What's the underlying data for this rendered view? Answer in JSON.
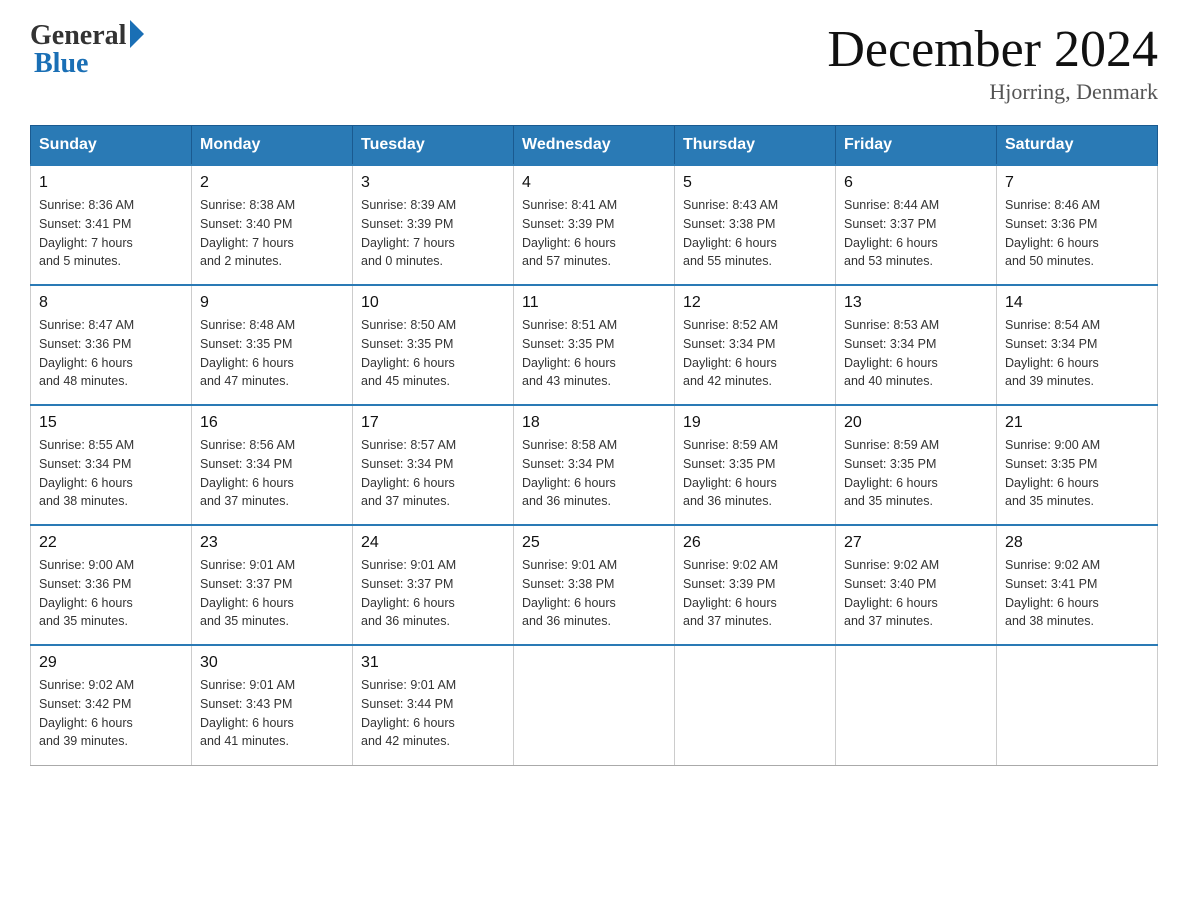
{
  "header": {
    "logo_general": "General",
    "logo_blue": "Blue",
    "title": "December 2024",
    "subtitle": "Hjorring, Denmark"
  },
  "days_of_week": [
    "Sunday",
    "Monday",
    "Tuesday",
    "Wednesday",
    "Thursday",
    "Friday",
    "Saturday"
  ],
  "weeks": [
    [
      {
        "day": "1",
        "sunrise": "8:36 AM",
        "sunset": "3:41 PM",
        "daylight": "7 hours and 5 minutes."
      },
      {
        "day": "2",
        "sunrise": "8:38 AM",
        "sunset": "3:40 PM",
        "daylight": "7 hours and 2 minutes."
      },
      {
        "day": "3",
        "sunrise": "8:39 AM",
        "sunset": "3:39 PM",
        "daylight": "7 hours and 0 minutes."
      },
      {
        "day": "4",
        "sunrise": "8:41 AM",
        "sunset": "3:39 PM",
        "daylight": "6 hours and 57 minutes."
      },
      {
        "day": "5",
        "sunrise": "8:43 AM",
        "sunset": "3:38 PM",
        "daylight": "6 hours and 55 minutes."
      },
      {
        "day": "6",
        "sunrise": "8:44 AM",
        "sunset": "3:37 PM",
        "daylight": "6 hours and 53 minutes."
      },
      {
        "day": "7",
        "sunrise": "8:46 AM",
        "sunset": "3:36 PM",
        "daylight": "6 hours and 50 minutes."
      }
    ],
    [
      {
        "day": "8",
        "sunrise": "8:47 AM",
        "sunset": "3:36 PM",
        "daylight": "6 hours and 48 minutes."
      },
      {
        "day": "9",
        "sunrise": "8:48 AM",
        "sunset": "3:35 PM",
        "daylight": "6 hours and 47 minutes."
      },
      {
        "day": "10",
        "sunrise": "8:50 AM",
        "sunset": "3:35 PM",
        "daylight": "6 hours and 45 minutes."
      },
      {
        "day": "11",
        "sunrise": "8:51 AM",
        "sunset": "3:35 PM",
        "daylight": "6 hours and 43 minutes."
      },
      {
        "day": "12",
        "sunrise": "8:52 AM",
        "sunset": "3:34 PM",
        "daylight": "6 hours and 42 minutes."
      },
      {
        "day": "13",
        "sunrise": "8:53 AM",
        "sunset": "3:34 PM",
        "daylight": "6 hours and 40 minutes."
      },
      {
        "day": "14",
        "sunrise": "8:54 AM",
        "sunset": "3:34 PM",
        "daylight": "6 hours and 39 minutes."
      }
    ],
    [
      {
        "day": "15",
        "sunrise": "8:55 AM",
        "sunset": "3:34 PM",
        "daylight": "6 hours and 38 minutes."
      },
      {
        "day": "16",
        "sunrise": "8:56 AM",
        "sunset": "3:34 PM",
        "daylight": "6 hours and 37 minutes."
      },
      {
        "day": "17",
        "sunrise": "8:57 AM",
        "sunset": "3:34 PM",
        "daylight": "6 hours and 37 minutes."
      },
      {
        "day": "18",
        "sunrise": "8:58 AM",
        "sunset": "3:34 PM",
        "daylight": "6 hours and 36 minutes."
      },
      {
        "day": "19",
        "sunrise": "8:59 AM",
        "sunset": "3:35 PM",
        "daylight": "6 hours and 36 minutes."
      },
      {
        "day": "20",
        "sunrise": "8:59 AM",
        "sunset": "3:35 PM",
        "daylight": "6 hours and 35 minutes."
      },
      {
        "day": "21",
        "sunrise": "9:00 AM",
        "sunset": "3:35 PM",
        "daylight": "6 hours and 35 minutes."
      }
    ],
    [
      {
        "day": "22",
        "sunrise": "9:00 AM",
        "sunset": "3:36 PM",
        "daylight": "6 hours and 35 minutes."
      },
      {
        "day": "23",
        "sunrise": "9:01 AM",
        "sunset": "3:37 PM",
        "daylight": "6 hours and 35 minutes."
      },
      {
        "day": "24",
        "sunrise": "9:01 AM",
        "sunset": "3:37 PM",
        "daylight": "6 hours and 36 minutes."
      },
      {
        "day": "25",
        "sunrise": "9:01 AM",
        "sunset": "3:38 PM",
        "daylight": "6 hours and 36 minutes."
      },
      {
        "day": "26",
        "sunrise": "9:02 AM",
        "sunset": "3:39 PM",
        "daylight": "6 hours and 37 minutes."
      },
      {
        "day": "27",
        "sunrise": "9:02 AM",
        "sunset": "3:40 PM",
        "daylight": "6 hours and 37 minutes."
      },
      {
        "day": "28",
        "sunrise": "9:02 AM",
        "sunset": "3:41 PM",
        "daylight": "6 hours and 38 minutes."
      }
    ],
    [
      {
        "day": "29",
        "sunrise": "9:02 AM",
        "sunset": "3:42 PM",
        "daylight": "6 hours and 39 minutes."
      },
      {
        "day": "30",
        "sunrise": "9:01 AM",
        "sunset": "3:43 PM",
        "daylight": "6 hours and 41 minutes."
      },
      {
        "day": "31",
        "sunrise": "9:01 AM",
        "sunset": "3:44 PM",
        "daylight": "6 hours and 42 minutes."
      },
      null,
      null,
      null,
      null
    ]
  ],
  "labels": {
    "sunrise": "Sunrise:",
    "sunset": "Sunset:",
    "daylight": "Daylight:"
  }
}
